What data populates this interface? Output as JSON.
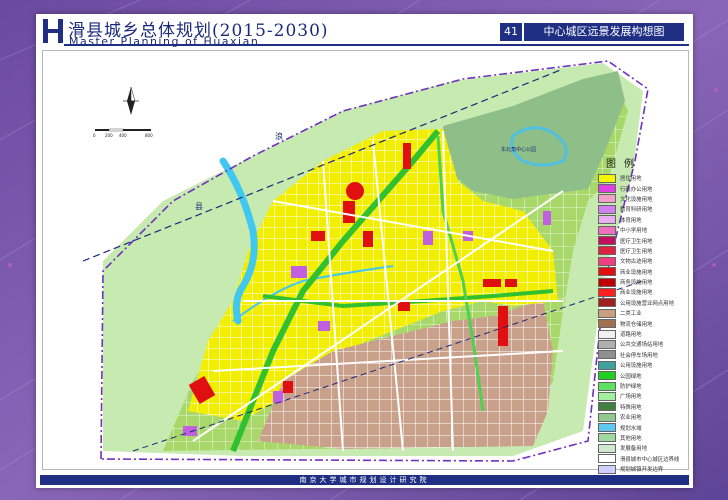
{
  "header": {
    "title_cn": "滑县城乡总体规划(2015-2030)",
    "title_en": "Master Planning of Huaxian",
    "page_number": "41",
    "page_title": "中心城区远景发展构想图"
  },
  "map": {
    "labels": {
      "lake": "东北角中心公园",
      "west_label_a": "浪",
      "west_label_b": "县"
    },
    "scale_labels": [
      "0",
      "200",
      "400",
      "800"
    ]
  },
  "legend": {
    "title": "图例",
    "items": [
      {
        "label": "居住用地",
        "color": "#f5f500"
      },
      {
        "label": "行政办公用地",
        "color": "#e040e0"
      },
      {
        "label": "文化设施用地",
        "color": "#f0a0c8"
      },
      {
        "label": "教育科研用地",
        "color": "#d080f0"
      },
      {
        "label": "体育用地",
        "color": "#e8b0f0"
      },
      {
        "label": "中小学用地",
        "color": "#f070c0"
      },
      {
        "label": "医疗卫生用地",
        "color": "#c01060"
      },
      {
        "label": "医疗卫生用地",
        "color": "#e02040"
      },
      {
        "label": "文物古迹用地",
        "color": "#f04080"
      },
      {
        "label": "商业设施用地",
        "color": "#e01010"
      },
      {
        "label": "商务设施用地",
        "color": "#c00000"
      },
      {
        "label": "商业设施用地",
        "color": "#ff2020"
      },
      {
        "label": "公用设施营业网点用地",
        "color": "#a02020"
      },
      {
        "label": "二类工业",
        "color": "#c8a080"
      },
      {
        "label": "物流仓储用地",
        "color": "#a07050"
      },
      {
        "label": "道路用地",
        "color": "#f0f0f0"
      },
      {
        "label": "公共交通场站用地",
        "color": "#b0b0b0"
      },
      {
        "label": "社会停车场用地",
        "color": "#909090"
      },
      {
        "label": "公用设施用地",
        "color": "#40a0a0"
      },
      {
        "label": "公园绿地",
        "color": "#20d020"
      },
      {
        "label": "防护绿地",
        "color": "#60e060"
      },
      {
        "label": "广场用地",
        "color": "#a0f0a0"
      },
      {
        "label": "特殊用地",
        "color": "#408040"
      },
      {
        "label": "农业用地",
        "color": "#90c890"
      },
      {
        "label": "规划水域",
        "color": "#60c8f0"
      },
      {
        "label": "其他用地",
        "color": "#a0d8a0"
      },
      {
        "label": "发展备用地",
        "color": "#d0e8d0"
      },
      {
        "label": "滑县城市中心城区边界线",
        "color": "#ffffff"
      },
      {
        "label": "规划城镇开发边界",
        "color": "#d0d0ff"
      },
      {
        "label": "县界",
        "color": "#f0f0ff"
      }
    ]
  },
  "footer": {
    "institute": "南京大学城市规划设计研究院"
  }
}
